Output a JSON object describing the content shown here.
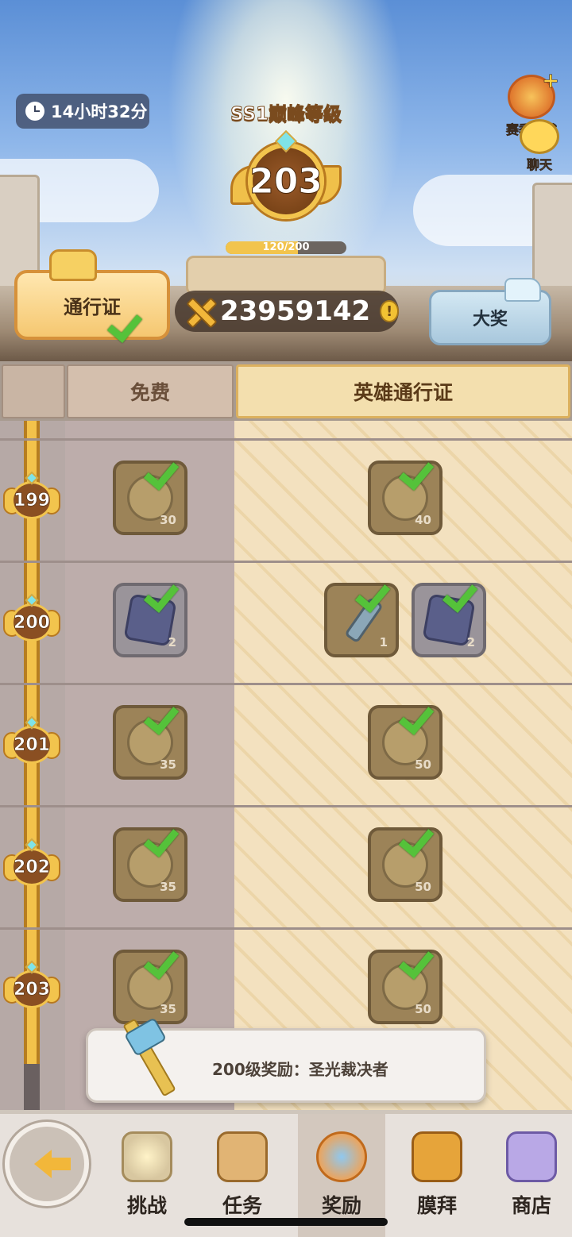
{
  "header": {
    "timer": "14小时32分",
    "season_title": "SS1巅峰等级",
    "level": "203",
    "xp_text": "120/200",
    "xp_progress": 0.6,
    "pass_label": "通行证",
    "currency_amount": "23959142",
    "currency_info": "!",
    "grand_prize_label": "大奖",
    "season_bonus_label": "赛季加成",
    "chat_label": "聊天"
  },
  "tabs": {
    "free": "免费",
    "hero_pass": "英雄通行证"
  },
  "rows": [
    {
      "level": "199",
      "free": [
        {
          "qty": "30",
          "icon": "coin-token-icon"
        }
      ],
      "hero": [
        {
          "qty": "40",
          "icon": "coin-token-icon"
        }
      ]
    },
    {
      "level": "200",
      "free": [
        {
          "qty": "2",
          "icon": "shield-crest-icon"
        }
      ],
      "hero": [
        {
          "qty": "1",
          "icon": "hammer-weapon-icon"
        },
        {
          "qty": "2",
          "icon": "shield-crest-icon"
        }
      ]
    },
    {
      "level": "201",
      "free": [
        {
          "qty": "35",
          "icon": "coin-token-icon"
        }
      ],
      "hero": [
        {
          "qty": "50",
          "icon": "coin-token-icon"
        }
      ]
    },
    {
      "level": "202",
      "free": [
        {
          "qty": "35",
          "icon": "coin-token-icon"
        }
      ],
      "hero": [
        {
          "qty": "50",
          "icon": "coin-token-icon"
        }
      ]
    },
    {
      "level": "203",
      "free": [
        {
          "qty": "35",
          "icon": "coin-token-icon"
        }
      ],
      "hero": [
        {
          "qty": "50",
          "icon": "coin-token-icon"
        }
      ]
    }
  ],
  "tooltip": {
    "text": "200级奖励：圣光裁决者"
  },
  "nav": {
    "challenge": "挑战",
    "tasks": "任务",
    "rewards": "奖励",
    "worship": "膜拜",
    "shop": "商店"
  },
  "colors": {
    "accent_gold": "#f2c44d",
    "check_green": "#55c23a",
    "hero_tab_bg": "#f3dfae"
  }
}
